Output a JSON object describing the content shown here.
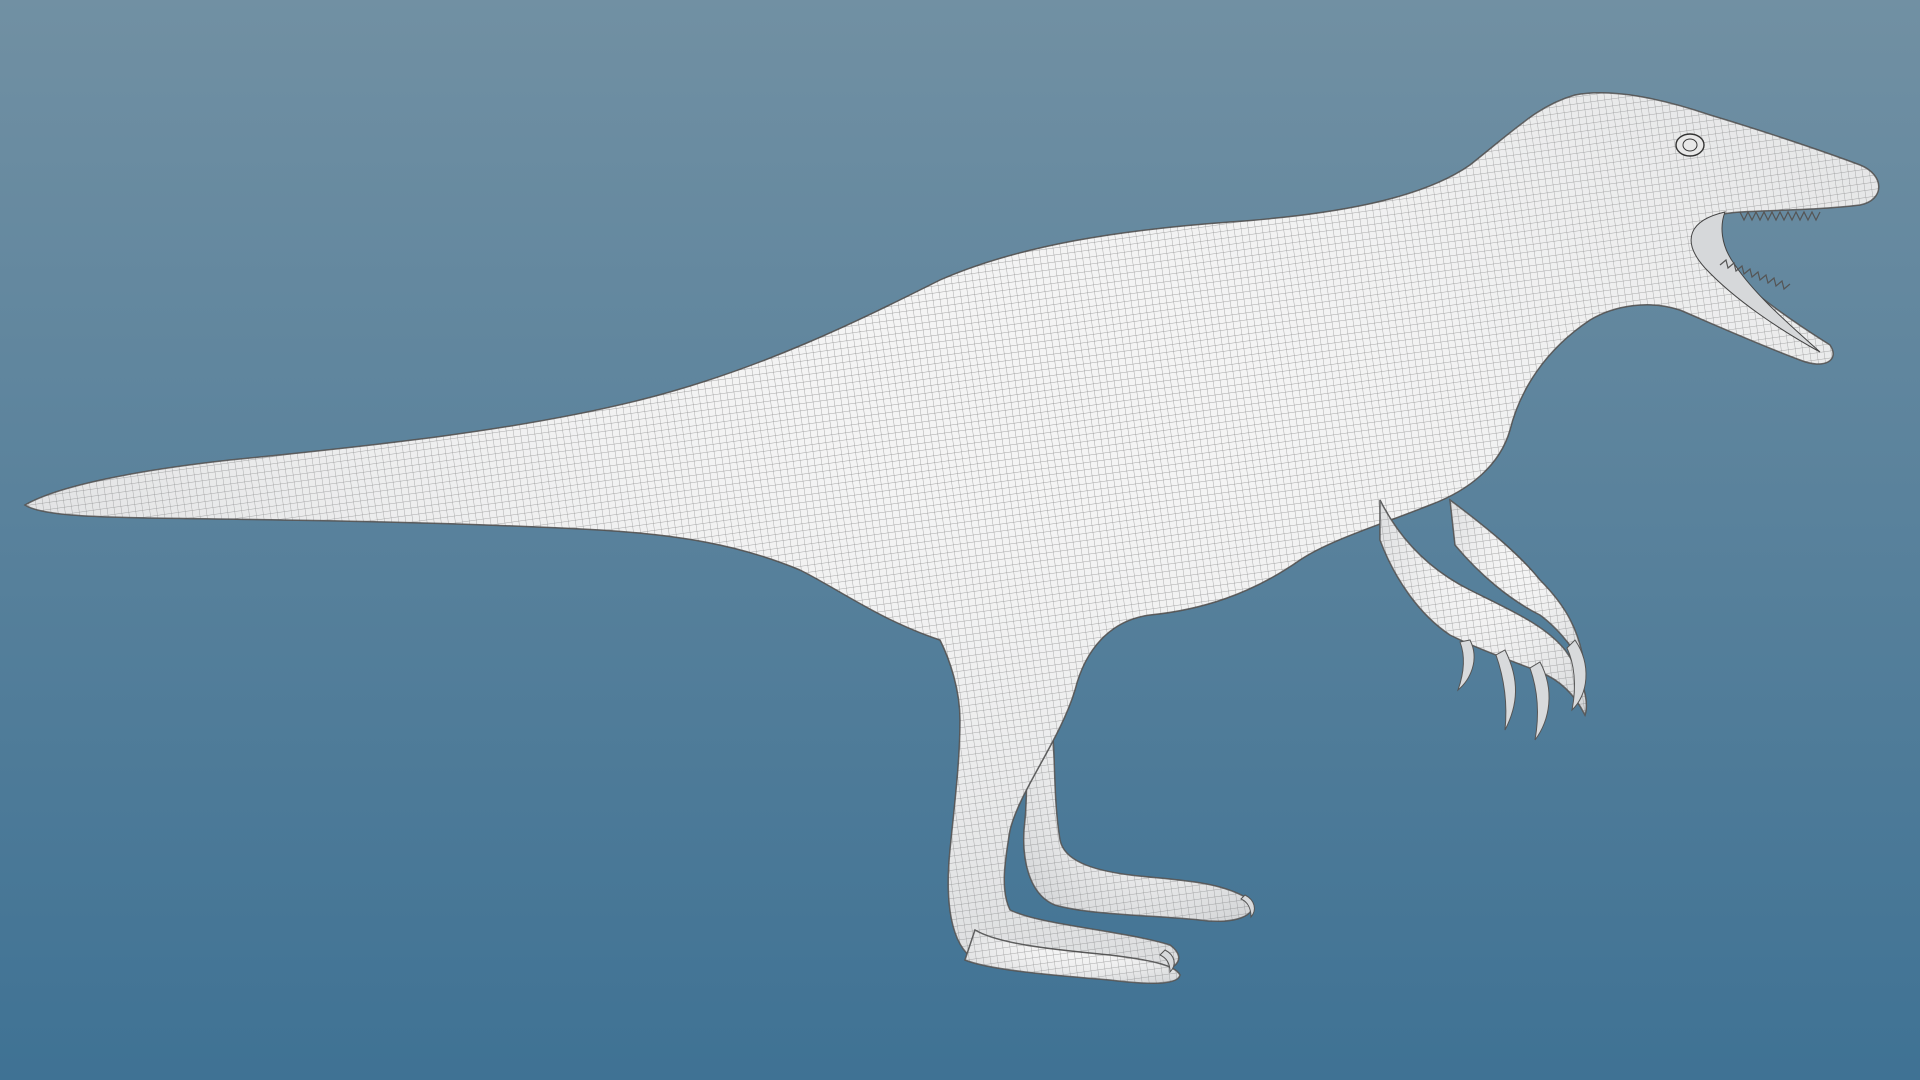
{
  "scene": {
    "subject": "dinosaur-wireframe-mesh",
    "colors": {
      "background_top": "#7190a3",
      "background_bottom": "#3f7294",
      "mesh_fill": "#f4f4f4",
      "mesh_shade": "#d8dadc",
      "wire": "#2f2f2f",
      "outline": "#555555"
    }
  }
}
